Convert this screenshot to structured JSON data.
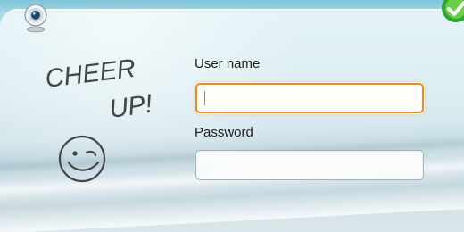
{
  "login": {
    "username_label": "User name",
    "username_value": "",
    "username_placeholder": "",
    "password_label": "Password",
    "password_value": "",
    "password_placeholder": ""
  },
  "handwriting": {
    "line1": "CHEER",
    "line2": "UP!"
  },
  "icons": {
    "webcam": "webcam-icon",
    "status": "green-status-icon",
    "smiley": "smiley-doodle-icon"
  },
  "colors": {
    "accent_focus": "#e88b26",
    "text": "#1d1d1d",
    "field_border": "#a9b0b5",
    "background": "#d7eef1"
  }
}
